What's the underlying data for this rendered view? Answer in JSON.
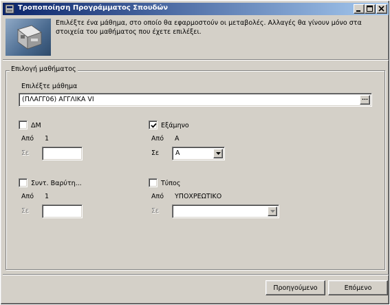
{
  "window": {
    "title": "Τροποποίηση Προγράμματος Σπουδών",
    "controls": {
      "minimize_icon": "minimize-icon",
      "maximize_icon": "maximize-icon",
      "close_icon": "close-icon"
    }
  },
  "header": {
    "icon": "course-schedule-icon",
    "description": "Επιλέξτε ένα μάθημα, στο οποίο θα εφαρμοστούν οι μεταβολές. Αλλαγές θα γίνουν μόνο στα στοιχεία του μαθήματος που έχετε επιλέξει."
  },
  "course_group": {
    "legend": "Επιλογή μαθήματος",
    "select_label": "Επιλέξτε μάθημα",
    "selected_course": "(ΠΛΑΓΓ06) ΑΓΓΛΙΚΑ VI",
    "browse_button": "..."
  },
  "fields": {
    "dm": {
      "label": "ΔΜ",
      "checked": false,
      "from_label": "Από",
      "from_value": "1",
      "to_label": "Σε",
      "to_value": ""
    },
    "semester": {
      "label": "Εξάμηνο",
      "checked": true,
      "from_label": "Από",
      "from_value": "Α",
      "to_label": "Σε",
      "to_value": "Α"
    },
    "weight": {
      "label": "Συντ. Βαρύτη...",
      "checked": false,
      "from_label": "Από",
      "from_value": "1",
      "to_label": "Σε",
      "to_value": ""
    },
    "type": {
      "label": "Τύπος",
      "checked": false,
      "from_label": "Από",
      "from_value": "ΥΠΟΧΡΕΩΤΙΚΟ",
      "to_label": "Σε",
      "to_value": ""
    }
  },
  "footer": {
    "previous_label": "Προηγούμενο",
    "next_label": "Επόμενο"
  }
}
